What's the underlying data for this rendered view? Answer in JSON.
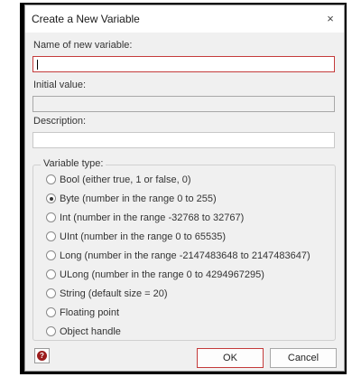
{
  "dialog": {
    "title": "Create a New Variable",
    "close_glyph": "×",
    "name_label": "Name of new variable:",
    "name_value": "",
    "initial_label": "Initial value:",
    "initial_value": "",
    "description_label": "Description:",
    "description_value": "",
    "type_group_label": "Variable type:",
    "options": [
      {
        "label": "Bool (either true, 1 or false, 0)",
        "checked": false
      },
      {
        "label": "Byte (number in the range 0 to 255)",
        "checked": true
      },
      {
        "label": "Int (number in the range -32768 to 32767)",
        "checked": false
      },
      {
        "label": "UInt (number in the range 0 to 65535)",
        "checked": false
      },
      {
        "label": "Long (number in the range -2147483648 to 2147483647)",
        "checked": false
      },
      {
        "label": "ULong (number in the range 0 to 4294967295)",
        "checked": false
      },
      {
        "label": "String (default size = 20)",
        "checked": false
      },
      {
        "label": "Floating point",
        "checked": false
      },
      {
        "label": "Object handle",
        "checked": false
      }
    ],
    "help_glyph": "?",
    "ok_label": "OK",
    "cancel_label": "Cancel"
  },
  "colors": {
    "accent_border": "#c43b3b",
    "help_icon": "#9b1c1c"
  }
}
